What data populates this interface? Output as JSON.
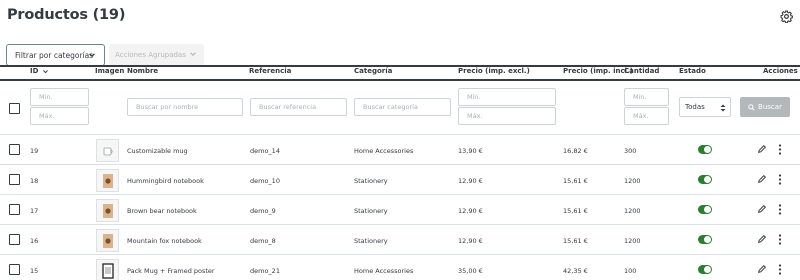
{
  "page": {
    "title": "Productos (19)"
  },
  "toolbar": {
    "filter_label": "Filtrar por categorías",
    "bulk_label": "Acciones Agrupadas"
  },
  "table": {
    "headers": {
      "id": "ID",
      "image": "Imagen",
      "name": "Nombre",
      "reference": "Referencia",
      "category": "Categoría",
      "price_excl": "Precio (imp. excl.)",
      "price_incl": "Precio (imp. incl.)",
      "quantity": "Cantidad",
      "status": "Estado",
      "actions": "Acciones"
    },
    "filters": {
      "id_min": "Min.",
      "id_max": "Máx.",
      "name": "Buscar por nombre",
      "reference": "Buscar referencia",
      "category": "Buscar categoría",
      "price_min": "Mín.",
      "price_max": "Máx.",
      "qty_min": "Mín.",
      "qty_max": "Máx.",
      "status_select": "Todas",
      "search_button": "Buscar"
    },
    "rows": [
      {
        "id": "19",
        "name": "Customizable mug",
        "reference": "demo_14",
        "category": "Home Accessories",
        "price_excl": "13,90 €",
        "price_incl": "16,82 €",
        "quantity": "300",
        "status": true,
        "thumb": "mug-thumbnail"
      },
      {
        "id": "18",
        "name": "Hummingbird notebook",
        "reference": "demo_10",
        "category": "Stationery",
        "price_excl": "12,90 €",
        "price_incl": "15,61 €",
        "quantity": "1200",
        "status": true,
        "thumb": "notebook-thumbnail"
      },
      {
        "id": "17",
        "name": "Brown bear notebook",
        "reference": "demo_9",
        "category": "Stationery",
        "price_excl": "12,90 €",
        "price_incl": "15,61 €",
        "quantity": "1200",
        "status": true,
        "thumb": "notebook-thumbnail"
      },
      {
        "id": "16",
        "name": "Mountain fox notebook",
        "reference": "demo_8",
        "category": "Stationery",
        "price_excl": "12,90 €",
        "price_incl": "15,61 €",
        "quantity": "1200",
        "status": true,
        "thumb": "notebook-thumbnail"
      },
      {
        "id": "15",
        "name": "Pack Mug + Framed poster",
        "reference": "demo_21",
        "category": "Home Accessories",
        "price_excl": "35,00 €",
        "price_incl": "42,35 €",
        "quantity": "100",
        "status": true,
        "thumb": "poster-thumbnail"
      }
    ]
  },
  "colors": {
    "accent_green": "#2e7d32",
    "text": "#363a41",
    "border": "#cdd4d9",
    "search_button_bg": "#b3b8bb"
  },
  "icons": [
    "gear-icon",
    "chevron-down-icon",
    "sort-icon",
    "search-icon",
    "pencil-icon",
    "kebab-icon"
  ]
}
